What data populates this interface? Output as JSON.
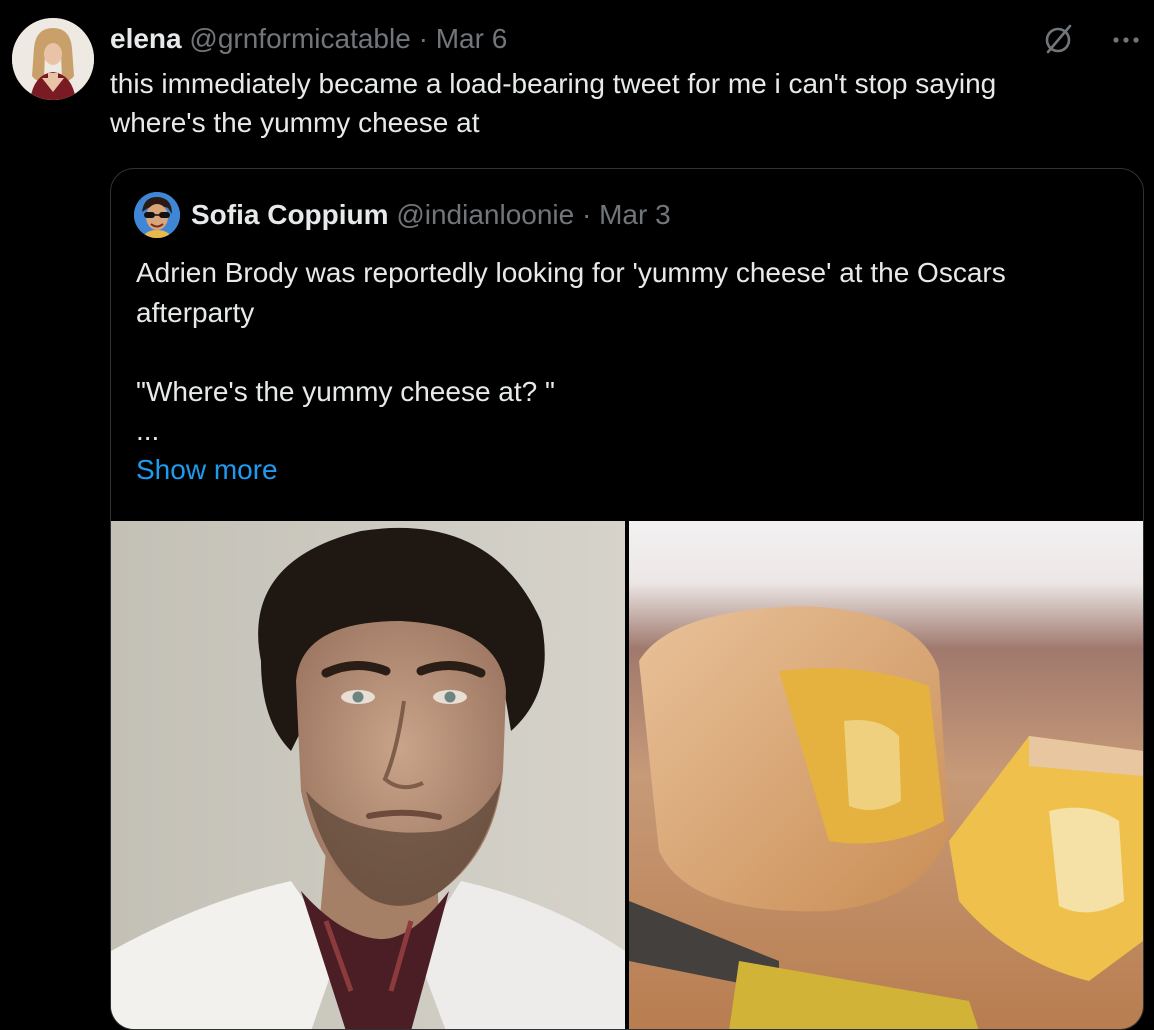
{
  "tweet": {
    "author_name": "elena",
    "handle": "@grnformicatable",
    "separator": "·",
    "date": "Mar 6",
    "text_lines": [
      "this immediately became a load-bearing tweet for me i can't stop saying",
      "where's the yummy cheese at"
    ],
    "more_glyph": "···"
  },
  "quote": {
    "author_name": "Sofia Coppium",
    "handle": "@indianloonie",
    "separator": "·",
    "date": "Mar 3",
    "text_lines": [
      "Adrien Brody was reportedly looking for 'yummy cheese' at the Oscars",
      "afterparty",
      "",
      "\"Where's the yummy cheese at? \"",
      "..."
    ],
    "show_more": "Show more"
  },
  "icons": {
    "grok": "grok-icon",
    "more": "more-icon"
  },
  "colors": {
    "background": "#000000",
    "text": "#e7e9ea",
    "muted": "#71767b",
    "link": "#1d9bf0",
    "border": "#2f3336"
  }
}
